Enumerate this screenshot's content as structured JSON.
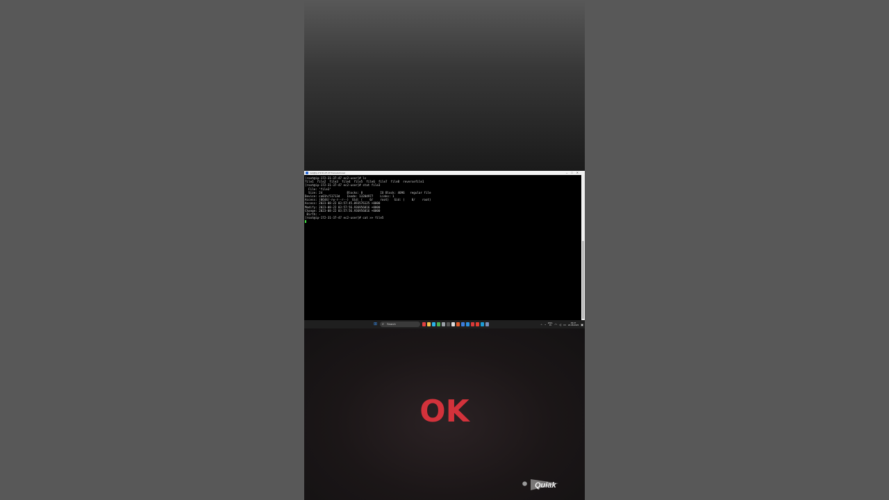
{
  "terminal": {
    "window_title": "root@ip-172-31-37-47:/home/ec2-user",
    "controls": [
      "–",
      "□",
      "✕"
    ],
    "lines": [
      "[root@ip-172-31-37-47 ec2-user]# ls",
      "file1  file2  file3  file4  file5  file6  file7  file8  reversefile1",
      "[root@ip-172-31-37-47 ec2-user]# stat file3",
      "  File: ‘file3’",
      "  Size: 24              Blocks: 8          IO Block: 4096   regular file",
      "Device: ca01h/51713d    Inode: 13204977    Links: 1",
      "Access: (0644/-rw-r--r--)  Uid: (    0/    root)   Gid: (    0/    root)",
      "Access: 2023-08-22 03:57:45.093576125 +0000",
      "Modify: 2023-08-22 03:57:56.936956016 +0000",
      "Change: 2023-08-22 03:57:56.936956016 +0000",
      " Birth: -",
      "[root@ip-172-31-37-47 ec2-user]# cat >> file5"
    ]
  },
  "taskbar": {
    "start_icon": "windows-start-icon",
    "search_label": "Search",
    "apps": [
      {
        "name": "app-red-icon",
        "color": "#e04040"
      },
      {
        "name": "file-explorer-icon",
        "color": "#f2c14e"
      },
      {
        "name": "edge-icon",
        "color": "#2bb3e8"
      },
      {
        "name": "chrome-icon",
        "color": "#4caf50"
      },
      {
        "name": "settings-icon",
        "color": "#9aa0a6"
      },
      {
        "name": "app-dark-icon",
        "color": "#555555"
      },
      {
        "name": "app-white-icon",
        "color": "#dddddd"
      },
      {
        "name": "app-orange-icon",
        "color": "#e05a2b"
      },
      {
        "name": "app-blue-icon",
        "color": "#3b7ddd"
      },
      {
        "name": "vscode-icon",
        "color": "#2a8fdf"
      },
      {
        "name": "app-red2-icon",
        "color": "#d83a3a"
      },
      {
        "name": "acrobat-icon",
        "color": "#e43d30"
      },
      {
        "name": "app-teal-icon",
        "color": "#1a9bd7"
      },
      {
        "name": "putty-icon",
        "color": "#7a8cb5"
      }
    ],
    "tray": {
      "language_top": "ENG",
      "language_bottom": "IN",
      "time": "09:27",
      "date": "22-08-2023"
    }
  },
  "overlay": {
    "caption": "OK",
    "caption_color": "#d3323b",
    "watermark": "Quiak"
  }
}
